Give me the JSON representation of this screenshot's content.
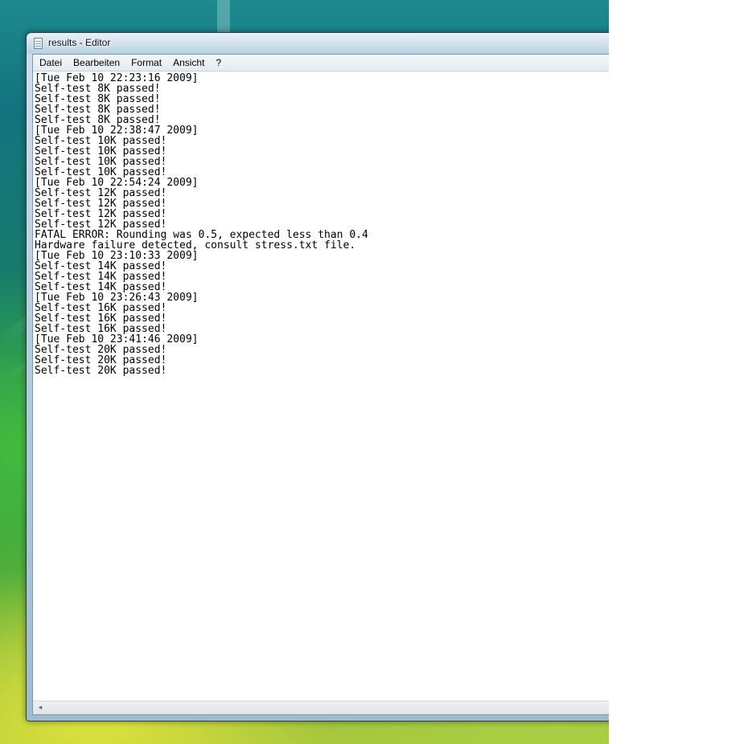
{
  "window": {
    "title": "results - Editor"
  },
  "menu": {
    "items": [
      "Datei",
      "Bearbeiten",
      "Format",
      "Ansicht",
      "?"
    ]
  },
  "editor": {
    "content": "[Tue Feb 10 22:23:16 2009]\nSelf-test 8K passed!\nSelf-test 8K passed!\nSelf-test 8K passed!\nSelf-test 8K passed!\n[Tue Feb 10 22:38:47 2009]\nSelf-test 10K passed!\nSelf-test 10K passed!\nSelf-test 10K passed!\nSelf-test 10K passed!\n[Tue Feb 10 22:54:24 2009]\nSelf-test 12K passed!\nSelf-test 12K passed!\nSelf-test 12K passed!\nSelf-test 12K passed!\nFATAL ERROR: Rounding was 0.5, expected less than 0.4\nHardware failure detected, consult stress.txt file.\n[Tue Feb 10 23:10:33 2009]\nSelf-test 14K passed!\nSelf-test 14K passed!\nSelf-test 14K passed!\n[Tue Feb 10 23:26:43 2009]\nSelf-test 16K passed!\nSelf-test 16K passed!\nSelf-test 16K passed!\n[Tue Feb 10 23:41:46 2009]\nSelf-test 20K passed!\nSelf-test 20K passed!\nSelf-test 20K passed!"
  },
  "scrollbar": {
    "left_arrow": "◂"
  },
  "icons": {
    "app": "notepad-icon",
    "scroll_left": "scroll-left-arrow-icon"
  }
}
